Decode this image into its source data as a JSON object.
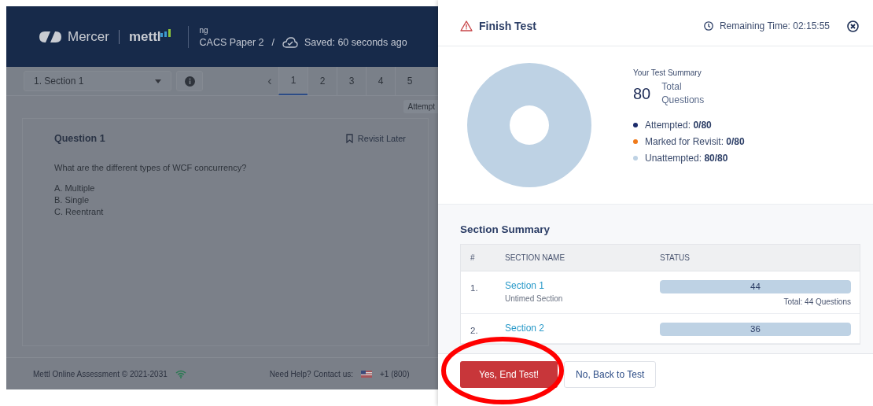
{
  "app": {
    "logo_left": "Mercer",
    "logo_right": "mettl",
    "user": "ng",
    "test_name": "CACS Paper 2",
    "separator": "/",
    "save_status": "Saved: 60 seconds ago"
  },
  "toolbar": {
    "section_select": "1. Section 1",
    "prev": "‹",
    "tooltip": "Attempt",
    "pages": [
      {
        "label": "1",
        "selected": true
      },
      {
        "label": "2",
        "selected": false
      },
      {
        "label": "3",
        "selected": false
      },
      {
        "label": "4",
        "selected": false
      },
      {
        "label": "5",
        "selected": false
      }
    ]
  },
  "question": {
    "title": "Question 1",
    "revisit": "Revisit Later",
    "text": "What are the different types of WCF concurrency?",
    "options": [
      "A. Multiple",
      "B. Single",
      "C. Reentrant"
    ]
  },
  "footer": {
    "copyright": "Mettl Online Assessment © 2021-2031",
    "help": "Need Help? Contact us:",
    "phone": "+1 (800)"
  },
  "dialog": {
    "title": "Finish Test",
    "remaining": "Remaining Time: 02:15:55",
    "summary_title": "Your Test Summary",
    "total": "80",
    "total_label": "Total Questions",
    "legend": [
      {
        "label": "Attempted:",
        "value": "0/80",
        "color": "#1b2b6b"
      },
      {
        "label": "Marked for Revisit:",
        "value": "0/80",
        "color": "#f07a1a"
      },
      {
        "label": "Unattempted:",
        "value": "80/80",
        "color": "#bed2e4"
      }
    ],
    "section_title": "Section Summary",
    "columns": [
      "#",
      "SECTION NAME",
      "STATUS"
    ],
    "sections": [
      {
        "index": "1.",
        "name": "Section 1",
        "subtitle": "Untimed Section",
        "count": "44",
        "level": 1,
        "total": "Total: 44 Questions"
      },
      {
        "index": "2.",
        "name": "Section 2",
        "count": "36",
        "level": 1
      }
    ],
    "confirm": "Yes, End Test!",
    "cancel": "No, Back to Test"
  },
  "annotation": {
    "kind": "ellipse"
  }
}
